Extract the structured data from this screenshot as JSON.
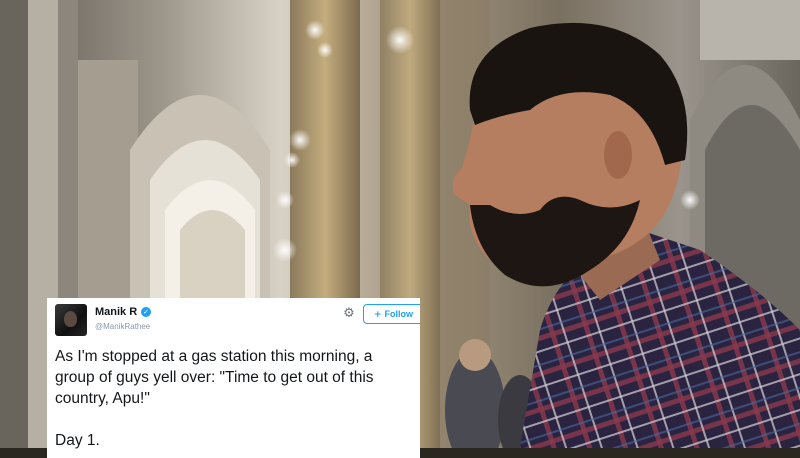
{
  "tweet": {
    "display_name": "Manik R",
    "handle": "@ManikRathee",
    "follow_label": "Follow",
    "text_lines": [
      "As I'm stopped at a gas station this morning, a",
      "group of guys yell over: \"Time to get out of this",
      "country, Apu!\"",
      "Day 1."
    ]
  },
  "icons": {
    "verified": "verified-badge-icon",
    "settings": "gear-icon",
    "follow": "add-user-icon"
  },
  "colors": {
    "twitter_blue": "#1da1f2",
    "card_background": "#ffffff",
    "text": "#14171a",
    "muted": "#8899a6"
  }
}
